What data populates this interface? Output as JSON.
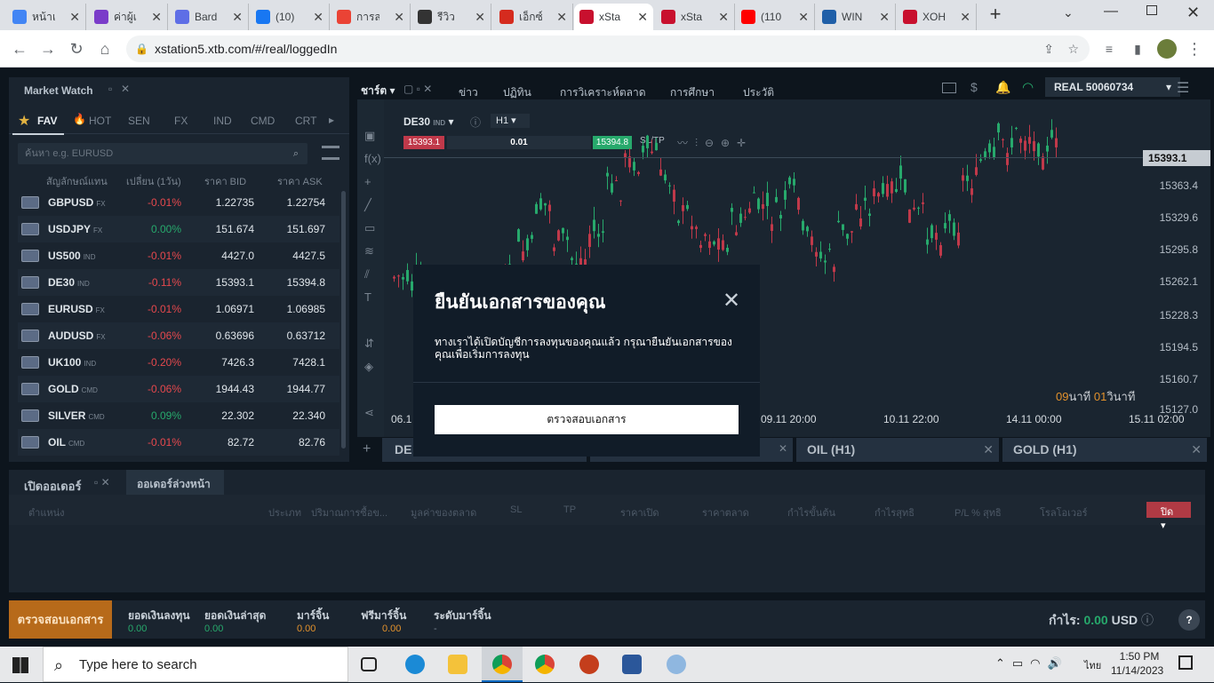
{
  "browser": {
    "tabs": [
      {
        "title": "หน้าแ",
        "color": "#4285f4"
      },
      {
        "title": "ค่าผู้เ",
        "color": "#7a3cc9"
      },
      {
        "title": "Bard",
        "color": "#5e6ee6"
      },
      {
        "title": "(10)",
        "color": "#1877f2"
      },
      {
        "title": "การส",
        "color": "#ea4335"
      },
      {
        "title": "รีวิว ",
        "color": "#333333"
      },
      {
        "title": "เอ็กซ์",
        "color": "#d52b1e"
      },
      {
        "title": "xSta",
        "color": "#c8102e"
      },
      {
        "title": "xSta",
        "color": "#c8102e"
      },
      {
        "title": "(110",
        "color": "#ff0000"
      },
      {
        "title": "WIN",
        "color": "#1f5fa8"
      },
      {
        "title": "XOH",
        "color": "#c8102e"
      }
    ],
    "url": "xstation5.xtb.com/#/real/loggedIn"
  },
  "market_watch": {
    "title": "Market Watch",
    "tabs": [
      "FAV",
      "HOT",
      "SEN",
      "FX",
      "IND",
      "CMD",
      "CRT"
    ],
    "search_placeholder": "ค้นหา e.g. EURUSD",
    "headers": [
      "สัญลักษณ์แทน",
      "เปลี่ยน (1วัน)",
      "ราคา BID",
      "ราคา ASK"
    ],
    "rows": [
      {
        "sym": "GBPUSD",
        "type": "FX",
        "chg": "-0.01%",
        "dir": "down",
        "bid": "1.22735",
        "ask": "1.22754"
      },
      {
        "sym": "USDJPY",
        "type": "FX",
        "chg": "0.00%",
        "dir": "up",
        "bid": "151.674",
        "ask": "151.697"
      },
      {
        "sym": "US500",
        "type": "IND",
        "chg": "-0.01%",
        "dir": "down",
        "bid": "4427.0",
        "ask": "4427.5"
      },
      {
        "sym": "DE30",
        "type": "IND",
        "chg": "-0.11%",
        "dir": "down",
        "bid": "15393.1",
        "ask": "15394.8"
      },
      {
        "sym": "EURUSD",
        "type": "FX",
        "chg": "-0.01%",
        "dir": "down",
        "bid": "1.06971",
        "ask": "1.06985"
      },
      {
        "sym": "AUDUSD",
        "type": "FX",
        "chg": "-0.06%",
        "dir": "down",
        "bid": "0.63696",
        "ask": "0.63712"
      },
      {
        "sym": "UK100",
        "type": "IND",
        "chg": "-0.20%",
        "dir": "down",
        "bid": "7426.3",
        "ask": "7428.1"
      },
      {
        "sym": "GOLD",
        "type": "CMD",
        "chg": "-0.06%",
        "dir": "down",
        "bid": "1944.43",
        "ask": "1944.77"
      },
      {
        "sym": "SILVER",
        "type": "CMD",
        "chg": "0.09%",
        "dir": "up",
        "bid": "22.302",
        "ask": "22.340"
      },
      {
        "sym": "OIL",
        "type": "CMD",
        "chg": "-0.01%",
        "dir": "down",
        "bid": "82.72",
        "ask": "82.76"
      }
    ]
  },
  "topnav": {
    "chart_tab": "ชาร์ต",
    "items": [
      "ข่าว",
      "ปฏิทิน",
      "การวิเคราะห์ตลาด",
      "การศึกษา",
      "ประวัติ"
    ],
    "account": "REAL",
    "account_no": "50060734"
  },
  "chart": {
    "symbol": "DE30",
    "symbol_type": "IND",
    "timeframe": "H1",
    "sell_price": "15393.1",
    "volume": "0.01",
    "buy_price": "15394.8",
    "sltp": "SL/TP",
    "current_price": "15393.1",
    "y_ticks": [
      "15363.4",
      "15329.6",
      "15295.8",
      "15262.1",
      "15228.3",
      "15194.5",
      "15160.7",
      "15127.0"
    ],
    "x_ticks": [
      "06.1",
      "09.11 20:00",
      "10.11 22:00",
      "14.11 00:00",
      "15.11 02:00"
    ],
    "timer_min": "09",
    "timer_min_label": "นาที",
    "timer_sec": "01",
    "timer_sec_label": "วินาที",
    "bottom_tabs": [
      "DE",
      "OIL (H1)",
      "GOLD (H1)"
    ]
  },
  "modal": {
    "title": "ยืนยันเอกสารของคุณ",
    "body": "ทางเราได้เปิดบัญชีการลงทุนของคุณแล้ว กรุณายืนยันเอกสารของคุณเพื่อเริ่มการลงทุน",
    "button": "ตรวจสอบเอกสาร"
  },
  "orders": {
    "tab_open": "เปิดออเดอร์",
    "tab_pending": "ออเดอร์ล่วงหน้า",
    "headers": [
      "ตำแหน่ง",
      "ประเภท",
      "ปริมาณการซื้อข...",
      "มูลค่าของตลาด",
      "SL",
      "TP",
      "ราคาเปิด",
      "ราคาตลาด",
      "กำไรขั้นต้น",
      "กำไรสุทธิ",
      "P/L % สุทธิ",
      "โรลโอเวอร์"
    ],
    "close_btn": "ปิด"
  },
  "footer": {
    "verify_btn": "ตรวจสอบเอกสาร",
    "stats": [
      {
        "label": "ยอดเงินลงทุน",
        "value": "0.00",
        "color": "green"
      },
      {
        "label": "ยอดเงินล่าสุด",
        "value": "0.00",
        "color": "green"
      },
      {
        "label": "มาร์จิ้น",
        "value": "0.00",
        "color": "orange"
      },
      {
        "label": "ฟรีมาร์จิ้น",
        "value": "0.00",
        "color": "orange"
      },
      {
        "label": "ระดับมาร์จิ้น",
        "value": "-",
        "color": "gray"
      }
    ],
    "profit_label": "กำไร:",
    "profit_value": "0.00",
    "currency": "USD"
  },
  "taskbar": {
    "search_placeholder": "Type here to search",
    "time": "1:50 PM",
    "date": "11/14/2023",
    "lang": "ไทย"
  }
}
